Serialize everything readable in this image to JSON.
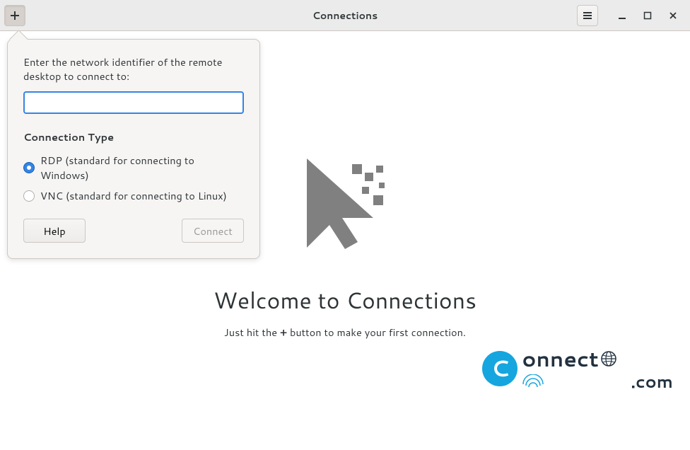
{
  "header": {
    "title": "Connections"
  },
  "popover": {
    "prompt": "Enter the network identifier of the remote desktop to connect to:",
    "input_value": "",
    "section_heading": "Connection Type",
    "options": [
      {
        "label": "RDP (standard for connecting to Windows)",
        "selected": true
      },
      {
        "label": "VNC (standard for connecting to Linux)",
        "selected": false
      }
    ],
    "help_label": "Help",
    "connect_label": "Connect",
    "connect_enabled": false
  },
  "empty_state": {
    "title": "Welcome to Connections",
    "subtitle_pre": "Just hit the ",
    "subtitle_plus": "+",
    "subtitle_post": " button to make your first connection."
  },
  "watermark": {
    "logo_letter": "C",
    "text": "onnect",
    "suffix": ".com"
  }
}
